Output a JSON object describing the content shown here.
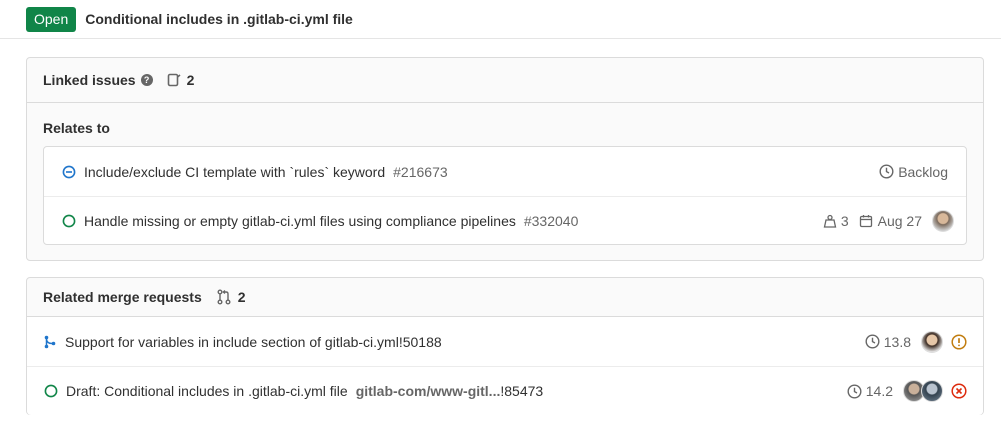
{
  "issue": {
    "status": "Open",
    "title": "Conditional includes in .gitlab-ci.yml file"
  },
  "linked_issues": {
    "title": "Linked issues",
    "help": "?",
    "count": "2",
    "group_label": "Relates to",
    "items": [
      {
        "title": "Include/exclude CI template with `rules` keyword",
        "ref": "#216673",
        "milestone": "Backlog",
        "state_icon": "issue-blocked-icon"
      },
      {
        "title": "Handle missing or empty gitlab-ci.yml files using compliance pipelines",
        "ref": "#332040",
        "weight": "3",
        "due_date": "Aug 27",
        "state_icon": "issue-open-icon",
        "assignee_icon": "avatar"
      }
    ]
  },
  "related_mrs": {
    "title": "Related merge requests",
    "count": "2",
    "items": [
      {
        "title": "Support for variables in include section of gitlab-ci.yml",
        "ref": "!50188",
        "milestone": "13.8",
        "status_icon": "merge-request-icon",
        "pipeline_icon": "warning-icon"
      },
      {
        "title": "Draft: Conditional includes in .gitlab-ci.yml file",
        "path": "gitlab-com/www-gitl...",
        "ref": "!85473",
        "milestone": "14.2",
        "status_icon": "mr-open-icon",
        "pipeline_icon": "failed-icon"
      }
    ]
  },
  "colors": {
    "open": "#108548",
    "warning": "#c17d10",
    "failed": "#dd2b0e",
    "blue": "#1f75cb"
  }
}
